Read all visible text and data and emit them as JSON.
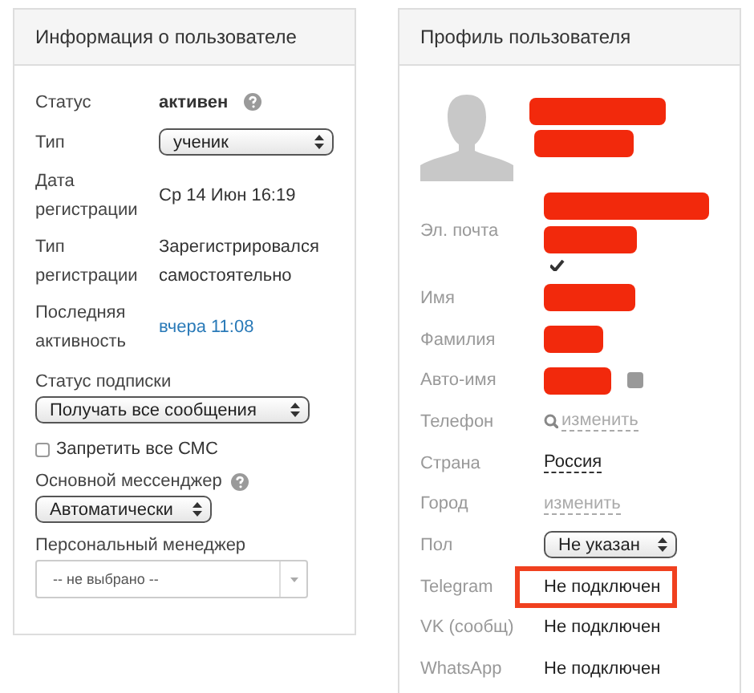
{
  "user_info": {
    "title": "Информация о пользователе",
    "fields": [
      {
        "kind": "status",
        "label": "Статус",
        "value": "активен",
        "help": true
      },
      {
        "kind": "select",
        "label": "Тип",
        "value": "ученик",
        "help": false
      },
      {
        "kind": "text",
        "label": "Дата регистрации",
        "value": "Ср 14 Июн 16:19",
        "help": false
      },
      {
        "kind": "text",
        "label": "Тип регистрации",
        "value": "Зарегистрировался самостоятельно",
        "help": false
      },
      {
        "kind": "link",
        "label": "Последняя активность",
        "value": "вчера 11:08",
        "help": false
      }
    ],
    "subscription": {
      "label": "Статус подписки",
      "value": "Получать все сообщения"
    },
    "block_sms": {
      "label": "Запретить все СМС",
      "checked": false
    },
    "messenger": {
      "label": "Основной мессенджер",
      "value": "Автоматически",
      "help": true
    },
    "manager": {
      "label": "Персональный менеджер",
      "placeholder": "-- не выбрано --"
    }
  },
  "profile": {
    "title": "Профиль пользователя",
    "name_redacted": true,
    "fields": [
      {
        "kind": "email",
        "label": "Эл. почта",
        "verified": true
      },
      {
        "kind": "redacted",
        "label": "Имя"
      },
      {
        "kind": "redacted",
        "label": "Фамилия"
      },
      {
        "kind": "redacted_check",
        "label": "Авто-имя",
        "checked": true
      },
      {
        "kind": "edit_link",
        "label": "Телефон",
        "value": "изменить",
        "search_icon": true
      },
      {
        "kind": "dashed",
        "label": "Страна",
        "value": "Россия"
      },
      {
        "kind": "edit_link",
        "label": "Город",
        "value": "изменить",
        "search_icon": false
      },
      {
        "kind": "select",
        "label": "Пол",
        "value": "Не указан"
      },
      {
        "kind": "text",
        "label": "Telegram",
        "value": "Не подключен",
        "highlighted": true
      },
      {
        "kind": "text",
        "label": "VK (сообщ)",
        "value": "Не подключен",
        "highlighted": false
      },
      {
        "kind": "text",
        "label": "WhatsApp",
        "value": "Не подключен",
        "highlighted": false
      }
    ]
  }
}
